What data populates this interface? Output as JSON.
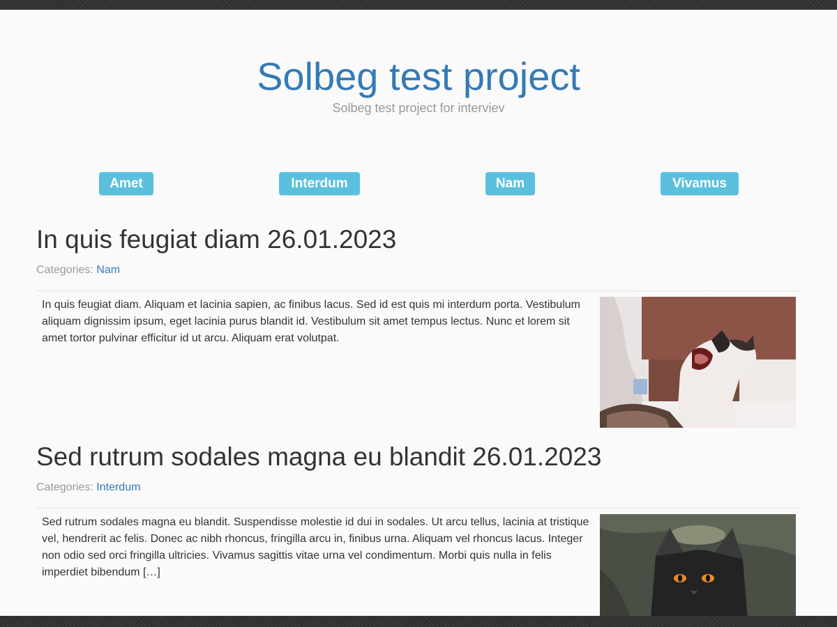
{
  "site": {
    "title": "Solbeg test project",
    "tagline": "Solbeg test project for interviev"
  },
  "nav": {
    "items": [
      {
        "label": "Amet"
      },
      {
        "label": "Interdum"
      },
      {
        "label": "Nam"
      },
      {
        "label": "Vivamus"
      }
    ]
  },
  "posts": [
    {
      "title": "In quis feugiat diam 26.01.2023",
      "categories_label": "Categories:",
      "category": "Nam",
      "excerpt": "In quis feugiat diam. Aliquam et lacinia sapien, ac finibus lacus. Sed id est quis mi interdum porta. Vestibulum aliquam dignissim ipsum, eget lacinia purus blandit id. Vestibulum sit amet tempus lectus. Nunc et lorem sit amet tortor pulvinar efficitur id ut arcu. Aliquam erat volutpat.",
      "thumb_icon": "yawning-cat-photo"
    },
    {
      "title": "Sed rutrum sodales magna eu blandit 26.01.2023",
      "categories_label": "Categories:",
      "category": "Interdum",
      "excerpt": "Sed rutrum sodales magna eu blandit. Suspendisse molestie id dui in sodales. Ut arcu tellus, lacinia at tristique vel, hendrerit ac felis. Donec ac nibh rhoncus, fringilla arcu in, finibus urna. Aliquam vel rhoncus lacus. Integer non odio sed orci fringilla ultricies. Vivamus sagittis vitae urna vel condimentum. Morbi quis nulla in felis imperdiet bibendum […]",
      "thumb_icon": "black-cat-photo"
    }
  ],
  "colors": {
    "accent": "#337ab7",
    "nav_button": "#5bc0de",
    "muted_text": "#999999",
    "background": "#fafafa"
  }
}
